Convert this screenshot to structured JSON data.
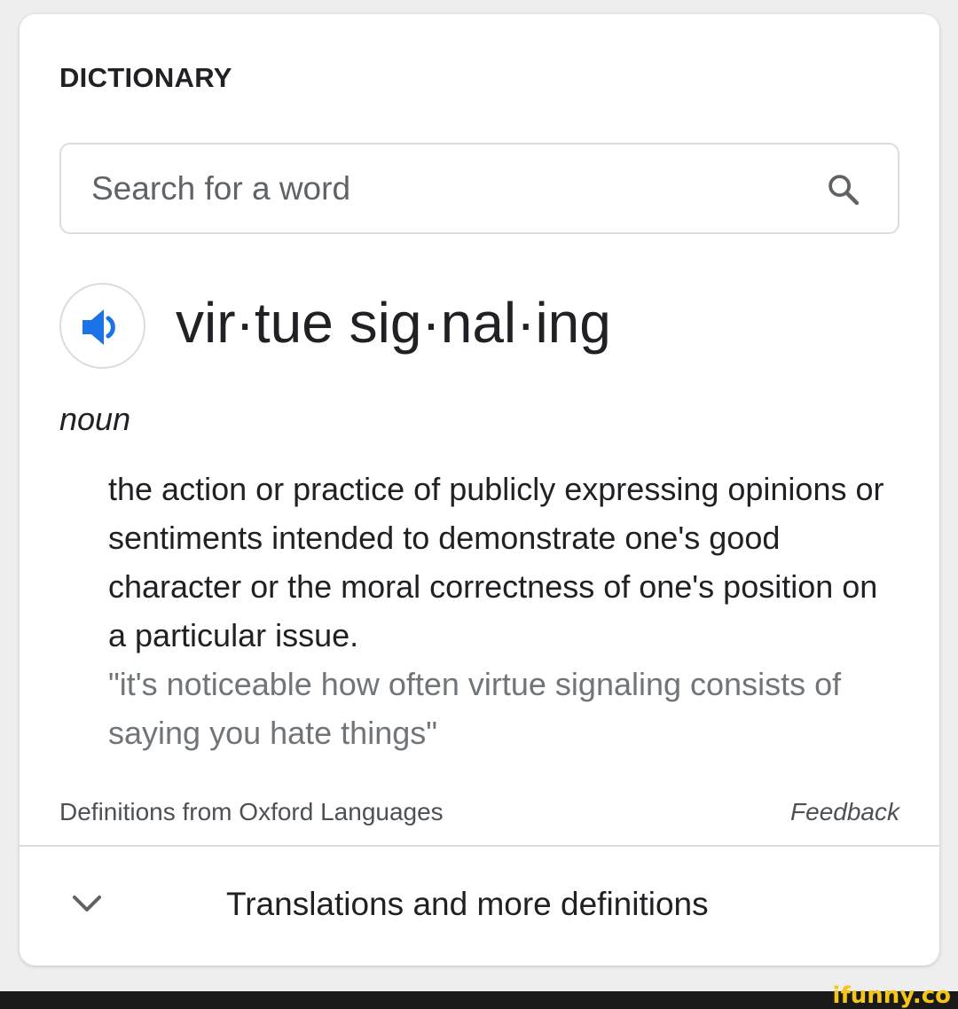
{
  "dictionary": {
    "header": "DICTIONARY",
    "search": {
      "placeholder": "Search for a word",
      "value": ""
    },
    "entry": {
      "headword": "vir·tue sig·nal·ing",
      "part_of_speech": "noun",
      "definition": "the action or practice of publicly expressing opinions or sentiments intended to demonstrate one's good character or the moral correctness of one's position on a particular issue.",
      "example": "\"it's noticeable how often virtue signaling consists of saying you hate things\""
    },
    "source": "Definitions from Oxford Languages",
    "feedback_label": "Feedback",
    "more_label": "Translations and more definitions"
  },
  "watermark": "ifunny.co",
  "icons": {
    "search": "search-icon",
    "audio": "speaker-icon",
    "expand": "chevron-down-icon"
  },
  "colors": {
    "accent_blue": "#1a73e8",
    "text": "#202124",
    "muted": "#70757a",
    "border": "#dadce0",
    "watermark": "#f5c518"
  }
}
